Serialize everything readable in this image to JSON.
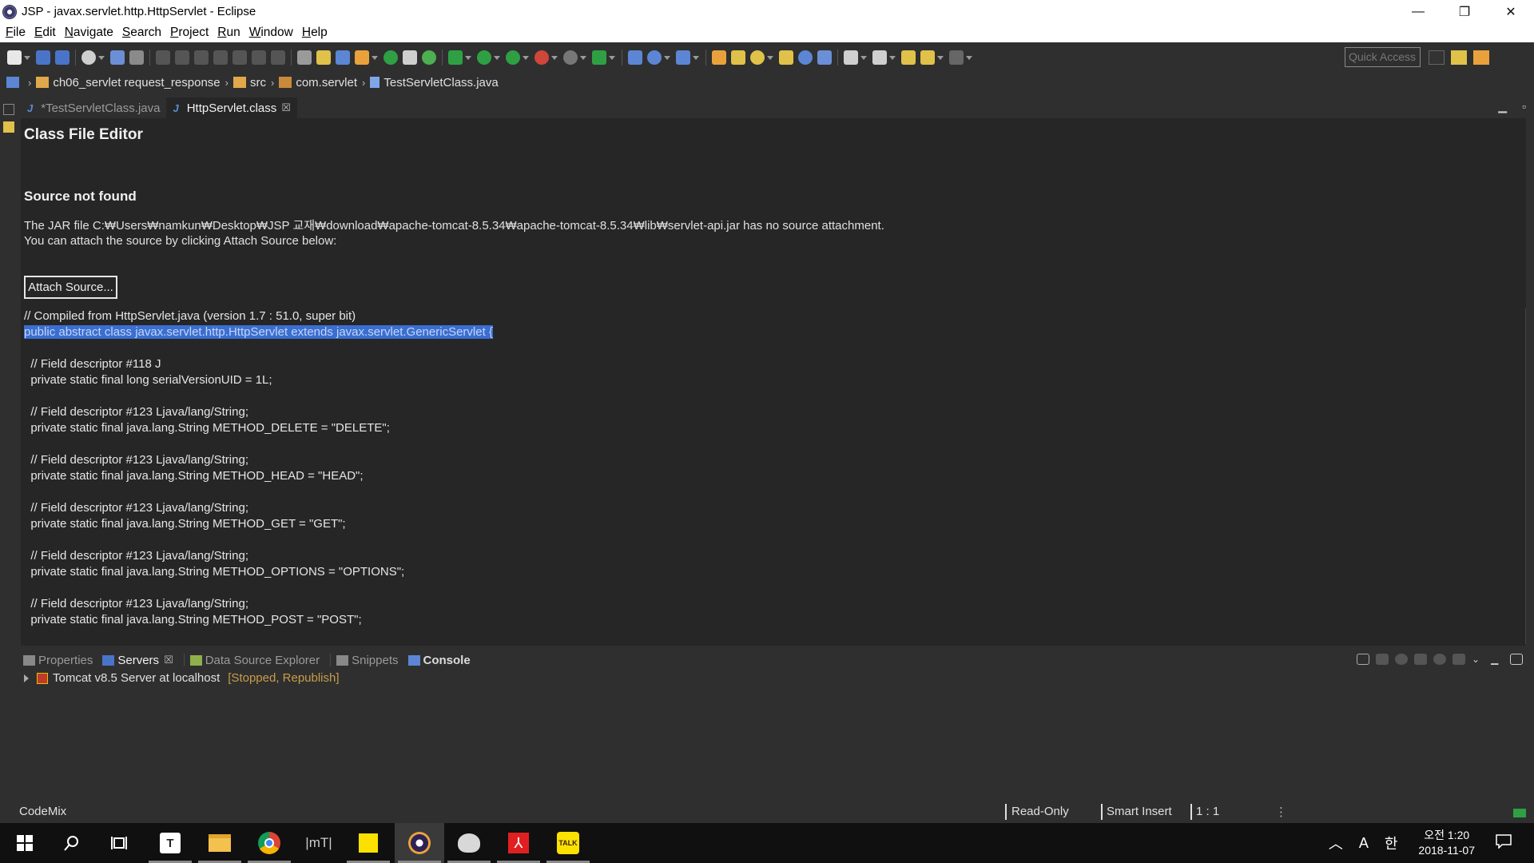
{
  "window": {
    "title": "JSP - javax.servlet.http.HttpServlet - Eclipse",
    "minimize_glyph": "—",
    "restore_glyph": "❐",
    "close_glyph": "✕"
  },
  "menu": [
    {
      "mnemonic": "F",
      "rest": "ile"
    },
    {
      "mnemonic": "E",
      "rest": "dit"
    },
    {
      "mnemonic": "N",
      "rest": "avigate"
    },
    {
      "mnemonic": "S",
      "rest": "earch"
    },
    {
      "mnemonic": "P",
      "rest": "roject"
    },
    {
      "mnemonic": "R",
      "rest": "un"
    },
    {
      "mnemonic": "W",
      "rest": "indow"
    },
    {
      "mnemonic": "H",
      "rest": "elp"
    }
  ],
  "toolbar": {
    "quick_access_placeholder": "Quick Access"
  },
  "breadcrumb": {
    "project": "ch06_servlet request_response",
    "folder": "src",
    "package": "com.servlet",
    "file": "TestServletClass.java",
    "sep": "›"
  },
  "editor_tabs": [
    {
      "label": "*TestServletClass.java",
      "icon": "java-file-icon",
      "active": false
    },
    {
      "label": "HttpServlet.class",
      "icon": "java-class-icon",
      "active": true,
      "close": "☒"
    }
  ],
  "editor": {
    "heading": "Class File Editor",
    "subheading": "Source not found",
    "message_line1": "The JAR file C:₩Users₩namkun₩Desktop₩JSP 교재₩download₩apache-tomcat-8.5.34₩apache-tomcat-8.5.34₩lib₩servlet-api.jar has no source attachment.",
    "message_line2": "You can attach the source by clicking Attach Source below:",
    "attach_button": "Attach Source...",
    "code": [
      "// Compiled from HttpServlet.java (version 1.7 : 51.0, super bit)",
      "public abstract class javax.servlet.http.HttpServlet extends javax.servlet.GenericServlet {",
      "",
      "  // Field descriptor #118 J",
      "  private static final long serialVersionUID = 1L;",
      "",
      "  // Field descriptor #123 Ljava/lang/String;",
      "  private static final java.lang.String METHOD_DELETE = \"DELETE\";",
      "",
      "  // Field descriptor #123 Ljava/lang/String;",
      "  private static final java.lang.String METHOD_HEAD = \"HEAD\";",
      "",
      "  // Field descriptor #123 Ljava/lang/String;",
      "  private static final java.lang.String METHOD_GET = \"GET\";",
      "",
      "  // Field descriptor #123 Ljava/lang/String;",
      "  private static final java.lang.String METHOD_OPTIONS = \"OPTIONS\";",
      "",
      "  // Field descriptor #123 Ljava/lang/String;",
      "  private static final java.lang.String METHOD_POST = \"POST\";"
    ],
    "selected_line": 1
  },
  "panel": {
    "tabs": [
      {
        "label": "Properties",
        "icon": "properties-icon"
      },
      {
        "label": "Servers",
        "icon": "servers-icon",
        "active": true,
        "close": "☒"
      },
      {
        "label": "Data Source Explorer",
        "icon": "data-source-icon"
      },
      {
        "label": "Snippets",
        "icon": "snippets-icon"
      },
      {
        "label": "Console",
        "icon": "console-icon"
      }
    ],
    "server_name": "Tomcat v8.5 Server at localhost",
    "server_state": "[Stopped, Republish]"
  },
  "status": {
    "left": "CodeMix",
    "mode": "Read-Only",
    "insert": "Smart Insert",
    "position": "1 : 1"
  },
  "taskbar": {
    "apps": [
      "start",
      "search",
      "task-view",
      "typora",
      "file-explorer",
      "chrome",
      "mt-app",
      "sticky-notes",
      "eclipse",
      "paint",
      "acrobat",
      "kakaotalk"
    ],
    "ime": "A",
    "lang": "한",
    "time": "오전 1:20",
    "date": "2018-11-07"
  },
  "colors": {
    "selection": "#3a6ed1",
    "server_state": "#c89d4a",
    "editor_bg": "#262626",
    "chrome_bg": "#2f2f2f"
  }
}
